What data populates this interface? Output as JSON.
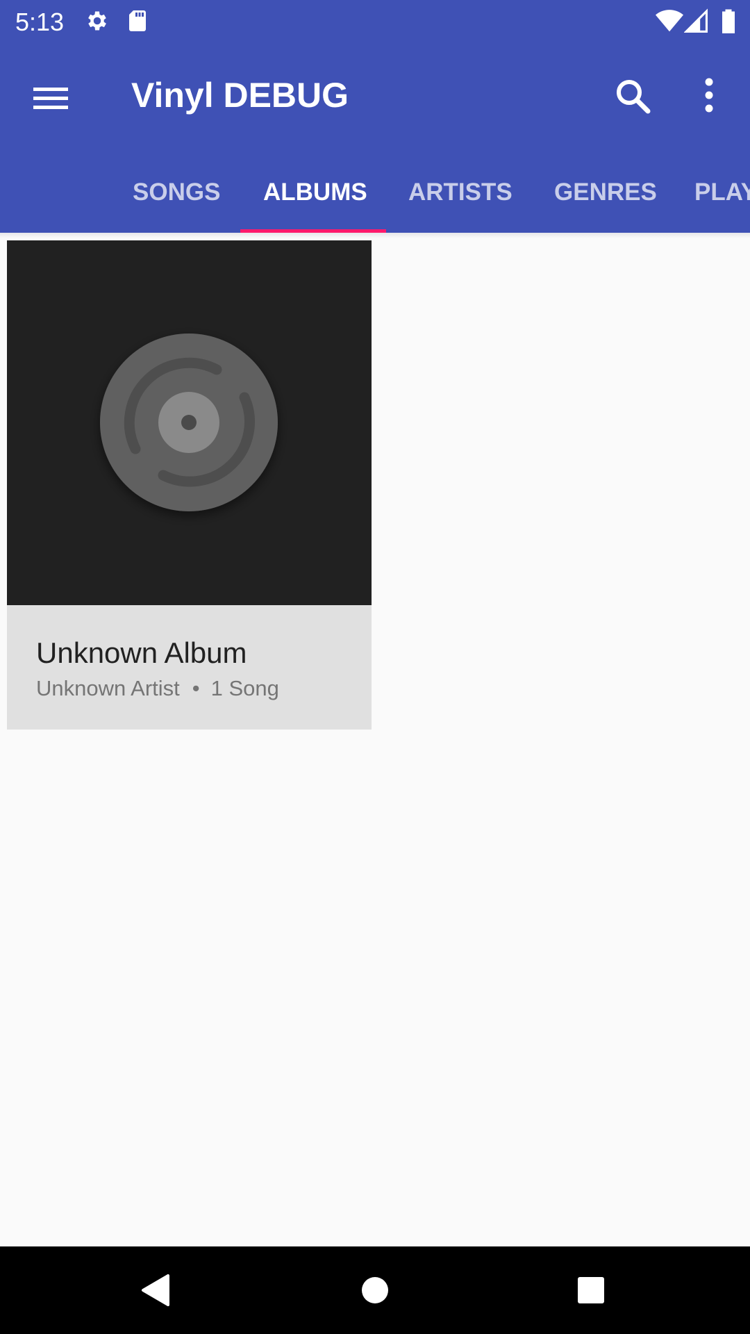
{
  "status_bar": {
    "time": "5:13",
    "icons": [
      "settings-icon",
      "sd-card-icon",
      "wifi-icon",
      "cell-signal-icon",
      "battery-icon"
    ]
  },
  "app_bar": {
    "title": "Vinyl DEBUG",
    "menu_icon": "menu-icon",
    "search_icon": "search-icon",
    "more_icon": "more-vert-icon"
  },
  "tabs": [
    {
      "label": "SONGS"
    },
    {
      "label": "ALBUMS"
    },
    {
      "label": "ARTISTS"
    },
    {
      "label": "GENRES"
    },
    {
      "label": "PLAYLISTS"
    }
  ],
  "active_tab": "ALBUMS",
  "albums": [
    {
      "title": "Unknown Album",
      "artist": "Unknown Artist",
      "separator": "•",
      "song_count": "1 Song"
    }
  ],
  "nav_bar": {
    "back_icon": "back-icon",
    "home_icon": "home-icon",
    "recents_icon": "recents-icon"
  },
  "colors": {
    "primary": "#3f51b5",
    "accent": "#ff1a6c",
    "album_art_bg": "#212121",
    "card_bg": "#e0e0e0"
  }
}
